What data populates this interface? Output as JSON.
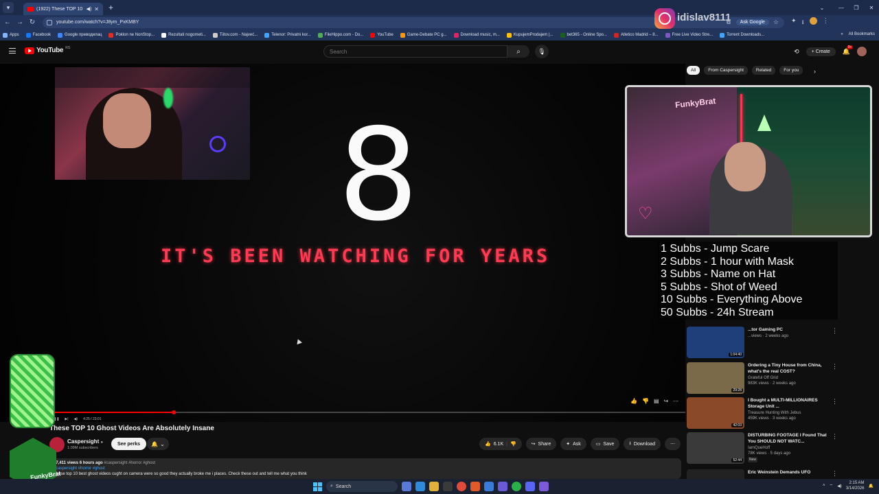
{
  "browser": {
    "tab_title": "(1922) These TOP 10 Ghost",
    "url": "youtube.com/watch?v=J8ym_PxKMBY",
    "ask_google": "Ask Google",
    "all_bookmarks": "All Bookmarks",
    "bookmarks": [
      {
        "label": "Apps",
        "color": "#8ab4f8"
      },
      {
        "label": "Facebook",
        "color": "#1877f2"
      },
      {
        "label": "Google преводилац",
        "color": "#4285f4"
      },
      {
        "label": "Poklon ne NonStop...",
        "color": "#d93025"
      },
      {
        "label": "Rezultati nogometi...",
        "color": "#ffffff"
      },
      {
        "label": "Tiitov.com - Najveć...",
        "color": "#cccccc"
      },
      {
        "label": "Telenor: Privatni kor...",
        "color": "#3ea6ff"
      },
      {
        "label": "FileHippo.com - Do...",
        "color": "#4caf50"
      },
      {
        "label": "YouTube",
        "color": "#ff0000"
      },
      {
        "label": "Game-Debate PC g...",
        "color": "#ff9800"
      },
      {
        "label": "Download music, m...",
        "color": "#e91e63"
      },
      {
        "label": "KupujemProdajem |...",
        "color": "#ffc107"
      },
      {
        "label": "bet365 - Online Spo...",
        "color": "#1b5e20"
      },
      {
        "label": "Atletico Madrid – 8...",
        "color": "#c62828"
      },
      {
        "label": "Free Live Video Stre...",
        "color": "#7e57c2"
      },
      {
        "label": "Torrent Downloads...",
        "color": "#42a5f5"
      }
    ]
  },
  "yt_header": {
    "logo": "YouTube",
    "logo_region": "RS",
    "search_placeholder": "Search",
    "create": "Create",
    "notif_count": "9+"
  },
  "overlay": {
    "instagram_handle": "idislav8111",
    "sub_goals": [
      "1 Subbs - Jump Scare",
      "2 Subbs - 1 hour with Mask",
      "3 Subbs - Name on Hat",
      "5 Subbs - Shot of Weed",
      "10 Subbs - Everything Above",
      "50 Subbs - 24h Stream"
    ],
    "webcam_sign": "FunkyBrat",
    "logo_text": "FunkyBrat"
  },
  "player": {
    "big_number": "8",
    "caption": "IT'S BEEN WATCHING FOR YEARS",
    "progress": 0.19,
    "time": "4:25 / 23:01"
  },
  "chips": [
    "All",
    "From Caspersight",
    "Related",
    "For you"
  ],
  "recommended": [
    {
      "title": "...tor Gaming PC",
      "channel": "",
      "stats": "...views · 2 weeks ago",
      "duration": "1:04:40",
      "new": "",
      "color": "#1e3f7a"
    },
    {
      "title": "Ordering a Tiny House from China, what's the real COST?",
      "channel": "Grateful Off Grid",
      "stats": "983K views · 2 weeks ago",
      "duration": "29:28",
      "new": "",
      "color": "#7a6a4a"
    },
    {
      "title": "I Bought a MULTI-MILLIONAIRES Storage Unit ...",
      "channel": "Treasure Hunting With Jebus",
      "stats": "459K views · 3 weeks ago",
      "duration": "42:03",
      "new": "",
      "color": "#8a4a2a"
    },
    {
      "title": "DISTURBING FOOTAGE I Found That You SHOULD NOT WATC...",
      "channel": "IamQueHoff",
      "stats": "78K views · 5 days ago",
      "duration": "52:44",
      "new": "New",
      "color": "#3a3a3a"
    },
    {
      "title": "Eric Weinstein Demands UFO",
      "channel": "",
      "stats": "",
      "duration": "",
      "new": "",
      "color": "#222222"
    }
  ],
  "video": {
    "title": "These TOP 10 Ghost Videos Are Absolutely Insane",
    "channel": "Caspersight",
    "subscribers": "1.09M subscribers",
    "see_perks": "See perks",
    "likes": "6.1K",
    "share": "Share",
    "ask": "Ask",
    "save": "Save",
    "download": "Download",
    "desc_stats": "57,411 views  6 hours ago",
    "desc_tags_inline": "#caspersight #horror #ghost",
    "desc_tags": "#caspersight #horror #ghost",
    "desc_text": "These top 10 best ghost videos cught on camera were so good they actually broke me i places. Check these out and tell me what you think"
  },
  "taskbar": {
    "search": "Search",
    "time": "2:15 AM",
    "date": "3/14/2026"
  }
}
